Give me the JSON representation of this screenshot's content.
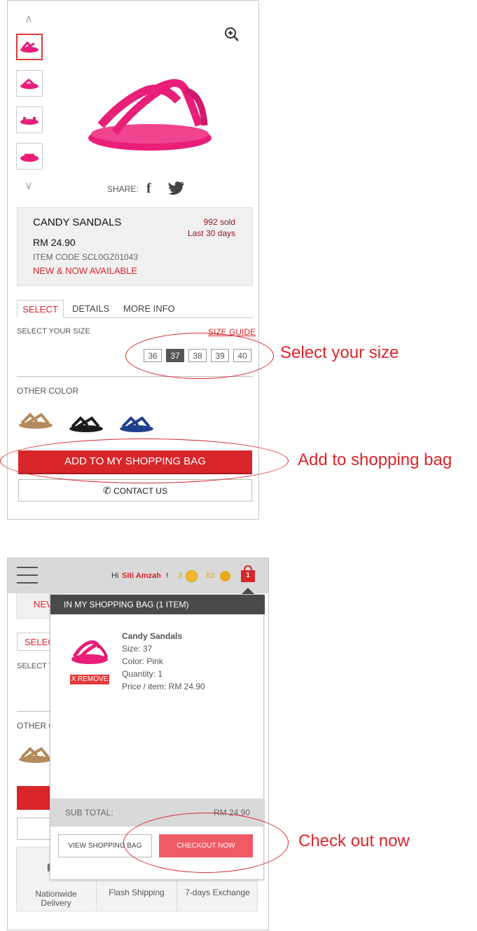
{
  "product": {
    "name": "CANDY SANDALS",
    "price": "RM 24.90",
    "item_code": "ITEM CODE SCL0GZ01043",
    "availability": "NEW & NOW AVAILABLE",
    "sold": "992 sold",
    "sold_period": "Last 30 days",
    "share_label": "SHARE:"
  },
  "tabs": [
    "SELECT",
    "DETAILS",
    "MORE INFO"
  ],
  "size_section": {
    "label": "SELECT YOUR SIZE",
    "guide": "SIZE GUIDE",
    "sizes": [
      "36",
      "37",
      "38",
      "39",
      "40"
    ],
    "selected": "37"
  },
  "other_color": {
    "label": "OTHER COLOR",
    "colors": [
      "#b48a5c",
      "#1c1c1c",
      "#1f3e8e"
    ]
  },
  "buttons": {
    "add_to_bag": "ADD TO MY SHOPPING BAG",
    "contact": "CONTACT US"
  },
  "annotations": {
    "select_size": "Select your size",
    "add_bag": "Add to shopping bag",
    "checkout": "Check out now"
  },
  "header": {
    "greeting": "Hi",
    "user": "Siti Amzah",
    "excl": "!",
    "points1": "3",
    "points2": "83",
    "bag_count": "1"
  },
  "bg_fragments": {
    "new": "NEV",
    "select": "SELEC",
    "select_size": "SELECT Y",
    "other_color": "OTHER C"
  },
  "bag": {
    "title": "IN MY SHOPPING BAG (1 ITEM)",
    "item_name": "Candy Sandals",
    "size": "Size: 37",
    "color": "Color: Pink",
    "quantity": "Quantity: 1",
    "price": "Price / item: RM 24.90",
    "remove": "X REMOVE",
    "subtotal_label": "SUB TOTAL:",
    "subtotal_value": "RM 24.90",
    "view_bag": "VIEW SHOPPING BAG",
    "checkout": "CHECKOUT NOW"
  },
  "features": [
    "Nationwide Delivery",
    "Flash Shipping",
    "7-days Exchange"
  ],
  "colors": {
    "accent": "#d8262b",
    "checkout": "#ef5a64"
  }
}
